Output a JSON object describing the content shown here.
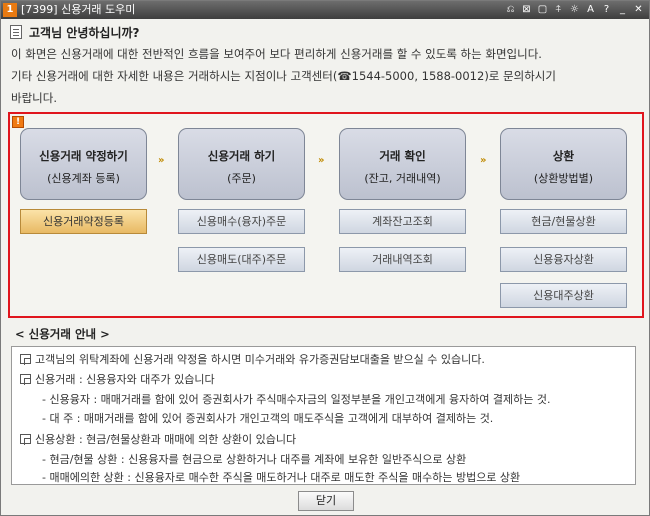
{
  "window": {
    "badge": "1",
    "title": "[7399] 신용거래 도우미",
    "toolbar_icons": [
      "mouse-icon",
      "close-box-icon",
      "copy-icon",
      "pin-icon",
      "brightness-icon",
      "font-icon",
      "help-icon",
      "minimize-icon",
      "close-icon"
    ],
    "toolbar_glyphs": [
      "⎌",
      "⊠",
      "▢",
      "⍏",
      "☼",
      "A",
      "?",
      "_",
      "✕"
    ]
  },
  "greeting": {
    "title": "고객님 안녕하십니까?",
    "lines": [
      "이 화면은 신용거래에 대한 전반적인 흐름을 보여주어 보다 편리하게 신용거래를 할 수 있도록 하는 화면입니다.",
      "기타 신용거래에 대한 자세한 내용은 거래하시는 지점이나 고객센터(☎1544-5000, 1588-0012)로 문의하시기",
      "바랍니다."
    ]
  },
  "flow": {
    "badge": "!",
    "arrow": "»",
    "steps": [
      {
        "title": "신용거래 약정하기",
        "sub": "(신용계좌 등록)"
      },
      {
        "title": "신용거래 하기",
        "sub": "(주문)"
      },
      {
        "title": "거래 확인",
        "sub": "(잔고, 거래내역)"
      },
      {
        "title": "상환",
        "sub": "(상환방법별)"
      }
    ],
    "actions": {
      "register": "신용거래약정등록",
      "buy_order": "신용매수(융자)주문",
      "sell_order": "신용매도(대주)주문",
      "balance": "계좌잔고조회",
      "history": "거래내역조회",
      "cash_repay": "현금/현물상환",
      "loan_repay": "신용융자상환",
      "stock_repay": "신용대주상환"
    }
  },
  "guide": {
    "title": "< 신용거래 안내 >",
    "lines": [
      "고객님의 위탁계좌에 신용거래 약정을 하시면 미수거래와 유가증권담보대출을 받으실 수 있습니다.",
      "신용거래 : 신용융자와 대주가 있습니다",
      "- 신용융자 : 매매거래를 함에 있어 증권회사가 주식매수자금의 일정부분을 개인고객에게 융자하여 결제하는 것.",
      "- 대      주 : 매매거래를 함에 있어 증권회사가 개인고객의 매도주식을 고객에게 대부하여 결제하는 것.",
      "신용상환 : 현금/현물상환과 매매에 의한 상환이 있습니다",
      "- 현금/현물 상환 : 신용융자를 현금으로 상환하거나 대주를 계좌에 보유한 일반주식으로 상환",
      "- 매매에의한 상환 : 신용융자로 매수한 주식을 매도하거나 대주로 매도한 주식을 매수하는 방법으로 상환"
    ]
  },
  "close_label": "닫기",
  "colors": {
    "highlight_border": "#e0151d",
    "primary_button": "#e8b964",
    "step_box": "#c8ccd8"
  }
}
